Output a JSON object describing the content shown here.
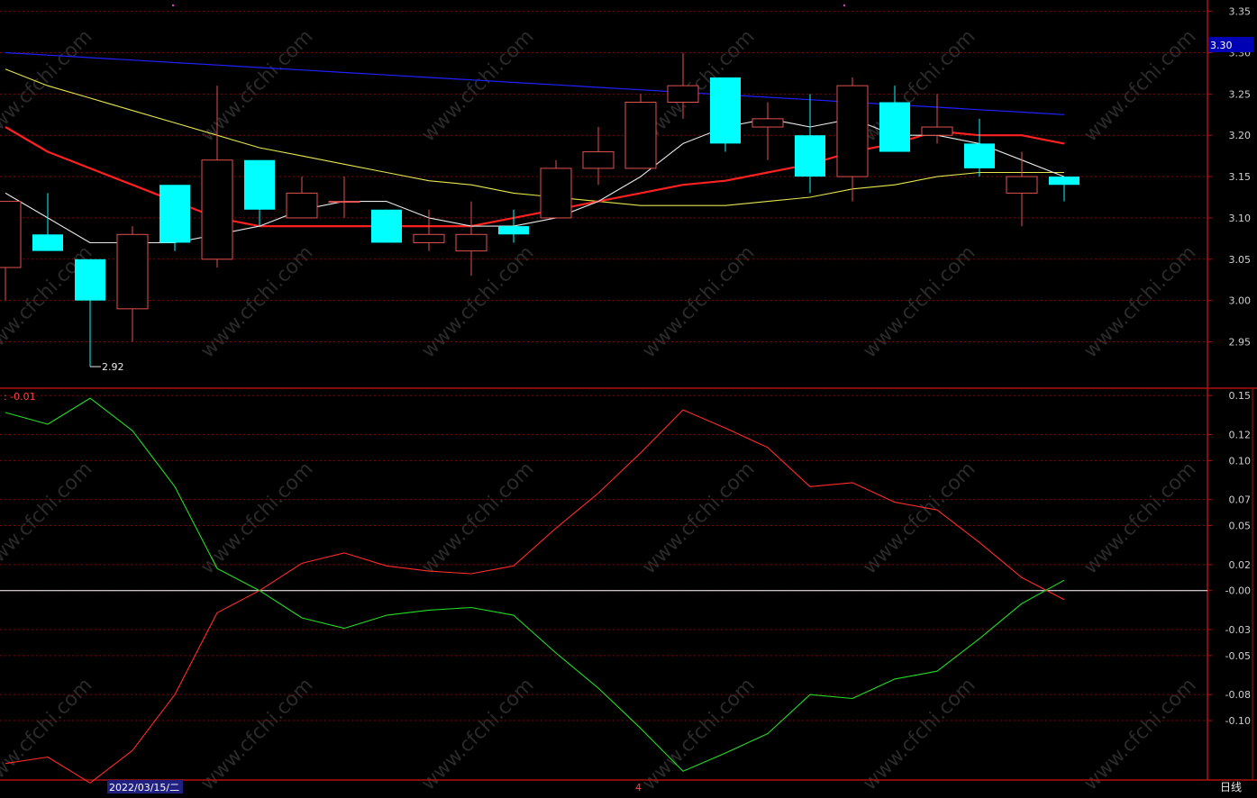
{
  "colors": {
    "background": "#000000",
    "grid": "#8b0000",
    "frame": "#b01010",
    "axis_text": "#cfcfcf",
    "up": "#e05050",
    "down": "#00ffff",
    "ma_white": "#e8e8e8",
    "ma_red": "#ff2020",
    "ma_yellow": "#e6e64c",
    "ma_blue": "#2020ff",
    "osc_red": "#ff2a2a",
    "osc_green": "#22dd22",
    "zero_line": "#ffffff",
    "price_tag_bg": "#0000b4",
    "date_tag_bg": "#202080",
    "watermark": "#2a2a2a"
  },
  "watermark_text": "www.cfchi.com",
  "price_panel": {
    "y_ticks": [
      "3.35",
      "3.30",
      "3.25",
      "3.20",
      "3.15",
      "3.10",
      "3.05",
      "3.00",
      "2.95"
    ],
    "y_range": [
      2.895,
      3.355
    ],
    "current_price_label": "3.30",
    "low_annotation": "2.92"
  },
  "osc_panel": {
    "header_label": ": -0.01",
    "y_ticks": [
      "0.15",
      "0.12",
      "0.10",
      "0.07",
      "0.05",
      "0.02",
      "-0.00",
      "-0.03",
      "-0.05",
      "-0.08",
      "-0.10"
    ],
    "y_range": [
      -0.145,
      0.155
    ]
  },
  "bottom_bar": {
    "date_label": "2022/03/15/二",
    "month_marker": "4",
    "period_label": "日线"
  },
  "chart_data": {
    "type": "candlestick",
    "candles": [
      {
        "o": 3.04,
        "h": 3.12,
        "l": 3.0,
        "c": 3.12
      },
      {
        "o": 3.08,
        "h": 3.13,
        "l": 3.06,
        "c": 3.06
      },
      {
        "o": 3.05,
        "h": 3.05,
        "l": 2.92,
        "c": 3.0
      },
      {
        "o": 2.99,
        "h": 3.09,
        "l": 2.95,
        "c": 3.08
      },
      {
        "o": 3.14,
        "h": 3.14,
        "l": 3.06,
        "c": 3.07
      },
      {
        "o": 3.05,
        "h": 3.26,
        "l": 3.04,
        "c": 3.17
      },
      {
        "o": 3.17,
        "h": 3.17,
        "l": 3.09,
        "c": 3.11
      },
      {
        "o": 3.1,
        "h": 3.15,
        "l": 3.1,
        "c": 3.13
      },
      {
        "o": 3.12,
        "h": 3.15,
        "l": 3.1,
        "c": 3.12
      },
      {
        "o": 3.11,
        "h": 3.11,
        "l": 3.07,
        "c": 3.07
      },
      {
        "o": 3.07,
        "h": 3.11,
        "l": 3.06,
        "c": 3.08
      },
      {
        "o": 3.06,
        "h": 3.12,
        "l": 3.03,
        "c": 3.08
      },
      {
        "o": 3.09,
        "h": 3.11,
        "l": 3.07,
        "c": 3.08
      },
      {
        "o": 3.1,
        "h": 3.17,
        "l": 3.1,
        "c": 3.16
      },
      {
        "o": 3.16,
        "h": 3.21,
        "l": 3.14,
        "c": 3.18
      },
      {
        "o": 3.16,
        "h": 3.25,
        "l": 3.16,
        "c": 3.24
      },
      {
        "o": 3.24,
        "h": 3.3,
        "l": 3.22,
        "c": 3.26
      },
      {
        "o": 3.27,
        "h": 3.27,
        "l": 3.18,
        "c": 3.19
      },
      {
        "o": 3.21,
        "h": 3.24,
        "l": 3.17,
        "c": 3.22
      },
      {
        "o": 3.2,
        "h": 3.25,
        "l": 3.13,
        "c": 3.15
      },
      {
        "o": 3.15,
        "h": 3.27,
        "l": 3.12,
        "c": 3.26
      },
      {
        "o": 3.24,
        "h": 3.26,
        "l": 3.18,
        "c": 3.18
      },
      {
        "o": 3.2,
        "h": 3.25,
        "l": 3.19,
        "c": 3.21
      },
      {
        "o": 3.19,
        "h": 3.22,
        "l": 3.15,
        "c": 3.16
      },
      {
        "o": 3.13,
        "h": 3.18,
        "l": 3.09,
        "c": 3.15
      },
      {
        "o": 3.15,
        "h": 3.15,
        "l": 3.12,
        "c": 3.14
      }
    ],
    "ma_white": [
      3.13,
      3.1,
      3.07,
      3.07,
      3.07,
      3.08,
      3.09,
      3.11,
      3.12,
      3.12,
      3.1,
      3.09,
      3.09,
      3.1,
      3.12,
      3.15,
      3.19,
      3.21,
      3.22,
      3.21,
      3.22,
      3.2,
      3.2,
      3.19,
      3.17,
      3.15
    ],
    "ma_red": [
      3.21,
      3.18,
      3.16,
      3.14,
      3.12,
      3.1,
      3.09,
      3.09,
      3.09,
      3.09,
      3.09,
      3.09,
      3.1,
      3.11,
      3.12,
      3.13,
      3.14,
      3.145,
      3.155,
      3.165,
      3.18,
      3.19,
      3.205,
      3.2,
      3.2,
      3.19
    ],
    "ma_yellow": [
      3.28,
      3.26,
      3.245,
      3.23,
      3.215,
      3.2,
      3.185,
      3.175,
      3.165,
      3.155,
      3.145,
      3.14,
      3.13,
      3.125,
      3.12,
      3.115,
      3.115,
      3.115,
      3.12,
      3.125,
      3.135,
      3.14,
      3.15,
      3.155,
      3.155,
      3.155
    ],
    "ma_blue": [
      3.3,
      3.297,
      3.294,
      3.291,
      3.288,
      3.285,
      3.282,
      3.279,
      3.276,
      3.273,
      3.27,
      3.267,
      3.264,
      3.261,
      3.258,
      3.255,
      3.252,
      3.249,
      3.246,
      3.243,
      3.24,
      3.237,
      3.234,
      3.231,
      3.228,
      3.225
    ],
    "osc_red": [
      -0.133,
      -0.128,
      -0.148,
      -0.123,
      -0.08,
      -0.017,
      0.0,
      0.021,
      0.029,
      0.019,
      0.015,
      0.013,
      0.019,
      0.048,
      0.075,
      0.106,
      0.139,
      0.125,
      0.11,
      0.08,
      0.083,
      0.068,
      0.062,
      0.037,
      0.01,
      -0.007
    ],
    "osc_green": [
      0.137,
      0.128,
      0.148,
      0.123,
      0.08,
      0.017,
      0.0,
      -0.021,
      -0.029,
      -0.019,
      -0.015,
      -0.013,
      -0.019,
      -0.048,
      -0.075,
      -0.106,
      -0.139,
      -0.125,
      -0.11,
      -0.08,
      -0.083,
      -0.068,
      -0.062,
      -0.037,
      -0.01,
      0.008
    ]
  }
}
